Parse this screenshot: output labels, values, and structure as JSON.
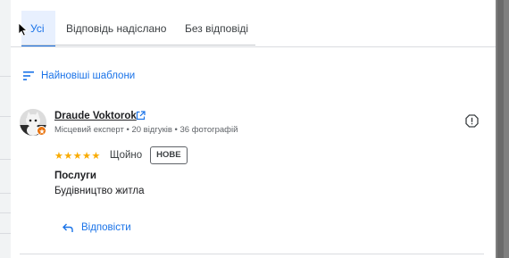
{
  "tabs": [
    {
      "label": "Усі",
      "active": true
    },
    {
      "label": "Відповідь надіслано",
      "active": false
    },
    {
      "label": "Без відповіді",
      "active": false
    }
  ],
  "sort": {
    "label": "Найновіші шаблони",
    "icon": "sort-icon"
  },
  "review": {
    "reviewer_name": "Draude Voktorok",
    "reviewer_meta": "Місцевий експерт • 20 відгуків • 36 фотографій",
    "stars": "★★★★★",
    "rating_value": 5,
    "rating_label": "Щойно",
    "new_badge": "НОВЕ",
    "service_title": "Послуги",
    "service_value": "Будівництво житла",
    "reply_label": "Відповісти"
  },
  "colors": {
    "accent": "#1a73e8",
    "star": "#f9ab00",
    "badge": "#e8710a"
  }
}
